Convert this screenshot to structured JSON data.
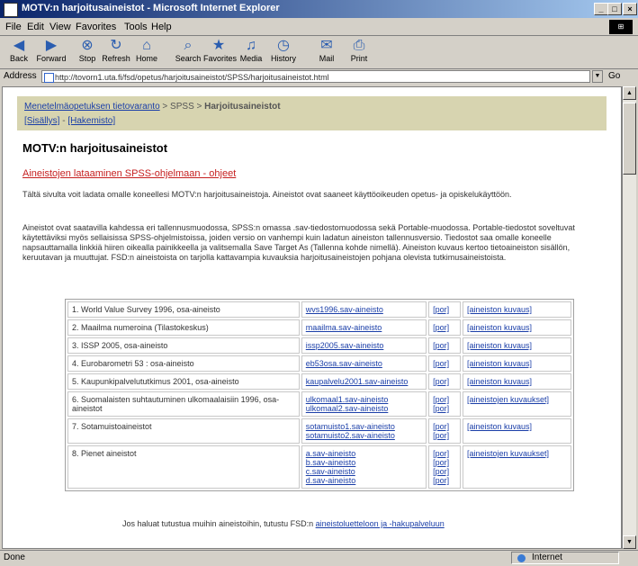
{
  "window": {
    "title": "MOTV:n harjoitusaineistot - Microsoft Internet Explorer",
    "controls": [
      "_",
      "□",
      "×"
    ]
  },
  "menu": [
    "File",
    "Edit",
    "View",
    "Favorites",
    "Tools",
    "Help"
  ],
  "toolbar": [
    {
      "label": "Back",
      "icon": "back-arrow"
    },
    {
      "label": "Forward",
      "icon": "forward-arrow"
    },
    {
      "label": "Stop",
      "icon": "stop"
    },
    {
      "label": "Refresh",
      "icon": "refresh"
    },
    {
      "label": "Home",
      "icon": "home"
    },
    {
      "label": "Search",
      "icon": "search"
    },
    {
      "label": "Favorites",
      "icon": "favorites"
    },
    {
      "label": "Media",
      "icon": "media"
    },
    {
      "label": "History",
      "icon": "history"
    },
    {
      "label": "Mail",
      "icon": "mail"
    },
    {
      "label": "Print",
      "icon": "print"
    }
  ],
  "address": {
    "label": "Address",
    "url": "http://tovorn1.uta.fi/fsd/opetus/harjoitusaineistot/SPSS/harjoitusaineistot.html",
    "go": "Go"
  },
  "breadcrumb": {
    "line1_link": "Menetelmäopetuksen tietovaranto",
    "line1_sep": " > SPSS > ",
    "line1_current": "Harjoitusaineistot",
    "line2_a": "[Sisällys]",
    "line2_b": "[Hakemisto]"
  },
  "page": {
    "heading": "MOTV:n harjoitusaineistot",
    "red_link": "Aineistojen lataaminen SPSS-ohjelmaan - ohjeet",
    "para1": "Tältä sivulta voit ladata omalle koneellesi MOTV:n harjoitusaineistoja. Aineistot ovat saaneet käyttöoikeuden opetus- ja opiskelukäyttöön.",
    "para2": "Aineistot ovat saatavilla kahdessa eri tallennusmuodossa, SPSS:n omassa .sav-tiedostomuodossa sekä Portable-muodossa. Portable-tiedostot soveltuvat käytettäviksi myös sellaisissa SPSS-ohjelmistoissa, joiden versio on vanhempi kuin ladatun aineiston tallennusversio. Tiedostot saa omalle koneelle napsauttamalla linkkiä hiiren oikealla painikkeella ja valitsemalla Save Target As (Tallenna kohde nimellä). Aineiston kuvaus kertoo tietoaineiston sisällön, keruutavan ja muuttujat. FSD:n aineistoista on tarjolla kattavampia kuvauksia harjoitusaineistojen pohjana olevista tutkimusaineistoista."
  },
  "table": [
    {
      "name": "1. World Value Survey 1996, osa-aineisto",
      "files": [
        "wvs1996.sav-aineisto"
      ],
      "spss": [
        "[por]"
      ],
      "vars": "[aineiston kuvaus]"
    },
    {
      "name": "2. Maailma numeroina (Tilastokeskus)",
      "files": [
        "maailma.sav-aineisto"
      ],
      "spss": [
        "[por]"
      ],
      "vars": "[aineiston kuvaus]"
    },
    {
      "name": "3. ISSP 2005, osa-aineisto",
      "files": [
        "issp2005.sav-aineisto"
      ],
      "spss": [
        "[por]"
      ],
      "vars": "[aineiston kuvaus]"
    },
    {
      "name": "4. Eurobarometri 53 : osa-aineisto",
      "files": [
        "eb53osa.sav-aineisto"
      ],
      "spss": [
        "[por]"
      ],
      "vars": "[aineiston kuvaus]"
    },
    {
      "name": "5. Kaupunkipalvelututkimus 2001, osa-aineisto",
      "files": [
        "kaupalvelu2001.sav-aineisto"
      ],
      "spss": [
        "[por]"
      ],
      "vars": "[aineiston kuvaus]"
    },
    {
      "name": "6. Suomalaisten suhtautuminen ulkomaalaisiin 1996, osa-aineistot",
      "files": [
        "ulkomaal1.sav-aineisto",
        "ulkomaal2.sav-aineisto"
      ],
      "spss": [
        "[por]",
        "[por]"
      ],
      "vars": "[aineistojen kuvaukset]"
    },
    {
      "name": "7. Sotamuistoaineistot",
      "files": [
        "sotamuisto1.sav-aineisto",
        "sotamuisto2.sav-aineisto"
      ],
      "spss": [
        "[por]",
        "[por]"
      ],
      "vars": "[aineiston kuvaus]"
    },
    {
      "name": "8. Pienet aineistot",
      "files": [
        "a.sav-aineisto",
        "b.sav-aineisto",
        "c.sav-aineisto",
        "d.sav-aineisto"
      ],
      "spss": [
        "[por]",
        "[por]",
        "[por]",
        "[por]"
      ],
      "vars": "[aineistojen kuvaukset]"
    }
  ],
  "footnote": {
    "text": "Jos haluat tutustua muihin aineistoihin, tutustu FSD:n ",
    "link": "aineistoluetteloon ja -hakupalveluun"
  },
  "status": {
    "left": "Done",
    "zone": "Internet"
  },
  "colors": {
    "titlebar": "#0a246a",
    "crumb_box": "#d7d4b0",
    "link": "#1a3ea8",
    "red_link": "#c62020"
  }
}
